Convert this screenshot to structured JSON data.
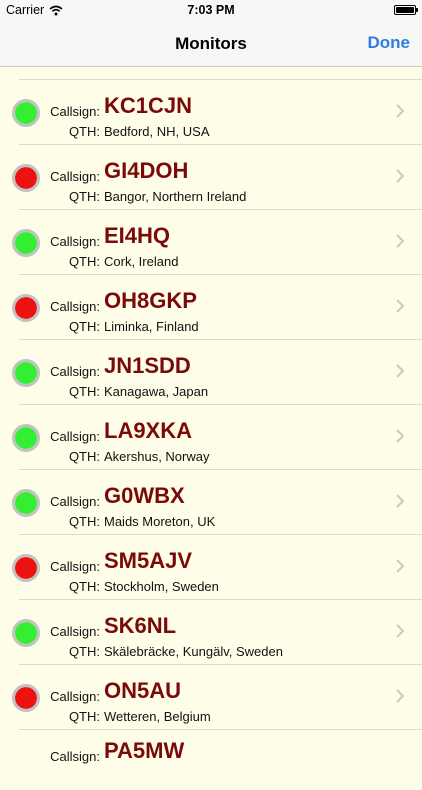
{
  "status_bar": {
    "carrier": "Carrier",
    "time": "7:03 PM"
  },
  "nav": {
    "title": "Monitors",
    "done_label": "Done"
  },
  "monitors": {
    "callsign_label": "Callsign:",
    "qth_label": "QTH:",
    "items": [
      {
        "status": "green",
        "callsign": "KC1CJN",
        "qth": "Bedford, NH, USA"
      },
      {
        "status": "red",
        "callsign": "GI4DOH",
        "qth": "Bangor, Northern Ireland"
      },
      {
        "status": "green",
        "callsign": "EI4HQ",
        "qth": "Cork, Ireland"
      },
      {
        "status": "red",
        "callsign": "OH8GKP",
        "qth": "Liminka, Finland"
      },
      {
        "status": "green",
        "callsign": "JN1SDD",
        "qth": "Kanagawa, Japan"
      },
      {
        "status": "green",
        "callsign": "LA9XKA",
        "qth": "Akershus, Norway"
      },
      {
        "status": "green",
        "callsign": "G0WBX",
        "qth": "Maids Moreton, UK"
      },
      {
        "status": "red",
        "callsign": "SM5AJV",
        "qth": "Stockholm, Sweden"
      },
      {
        "status": "green",
        "callsign": "SK6NL",
        "qth": "Skälebräcke, Kungälv, Sweden"
      },
      {
        "status": "red",
        "callsign": "ON5AU",
        "qth": "Wetteren, Belgium"
      }
    ],
    "partial_next": {
      "callsign_label": "Callsign:",
      "callsign": "PA5MW"
    }
  }
}
